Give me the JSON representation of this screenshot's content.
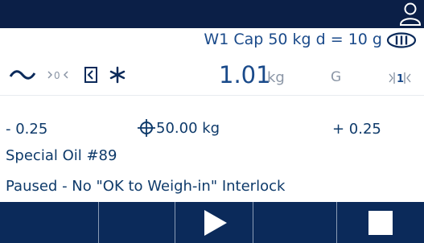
{
  "header": {
    "user_icon": "user-icon"
  },
  "metrology": {
    "text": "W1 Cap 50 kg d = 10 g",
    "approval_icon": "approval-class-III-icon"
  },
  "status_icons": [
    "motion-icon",
    "center-of-zero-icon",
    "scale-status-icon",
    "asterisk-icon"
  ],
  "weight": {
    "value": "1.01",
    "unit": "kg",
    "mode": "G",
    "range_icon": "range-1-icon"
  },
  "targets": {
    "under_tolerance": "- 0.25",
    "target_value": "50.00 kg",
    "target_icon": "target-icon",
    "over_tolerance": "+ 0.25"
  },
  "material": "Special Oil #89",
  "status_message": "Paused - No \"OK to Weigh-in\" Interlock",
  "softkeys": [
    "",
    "",
    "play-icon",
    "",
    "stop-icon"
  ],
  "colors": {
    "topbar": "#0b1f47",
    "softkey_bg": "#0b2a5a",
    "text": "#0e3a6a",
    "accent": "#1a4a8a"
  }
}
